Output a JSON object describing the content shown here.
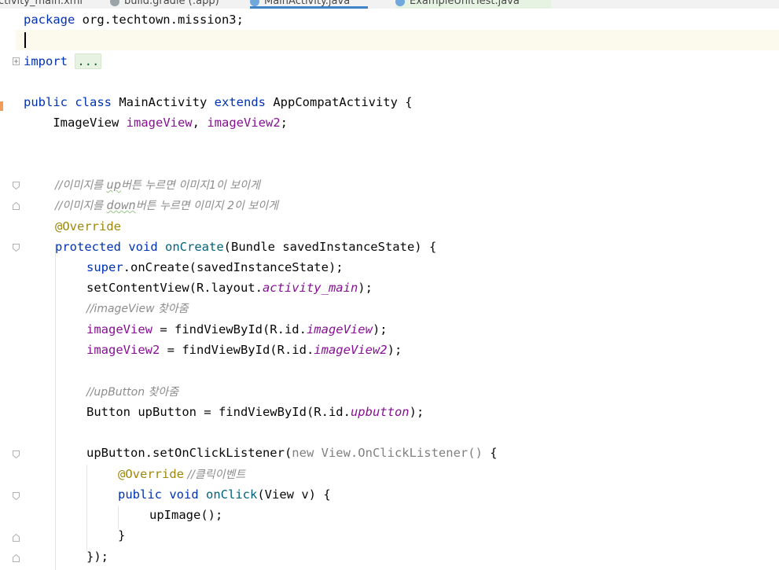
{
  "tabs": [
    {
      "label": "ctivity_main.xml"
    },
    {
      "label": "build.gradle (:app)"
    },
    {
      "label": "MainActivity.java"
    },
    {
      "label": "ExampleUnitTest.java"
    }
  ],
  "code": {
    "package_kw": "package",
    "package_name": " org.techtown.mission3;",
    "import_kw": "import",
    "import_fold": "...",
    "class_public": "public",
    "class_kw": "class",
    "class_name": " MainActivity ",
    "extends_kw": "extends",
    "super_class": " AppCompatActivity {",
    "field_type": "    ImageView ",
    "field1": "imageView",
    "field_sep": ", ",
    "field2": "imageView2",
    "field_end": ";",
    "comment1_prefix": "//이미지를 ",
    "comment1_up": "up",
    "comment1_rest": "버튼 누르면 이미지1이 보이게",
    "comment2_prefix": "//이미지를 ",
    "comment2_down": "down",
    "comment2_rest": "버튼 누르면 이미지 2이 보이게",
    "override": "@Override",
    "protected_kw": "protected",
    "void_kw": "void",
    "oncreate": "onCreate",
    "oncreate_params": "(Bundle savedInstanceState) {",
    "super_kw": "super",
    "super_call": ".onCreate(savedInstanceState);",
    "setcontent": "setContentView(R.layout.",
    "activity_main": "activity_main",
    "close_paren": ");",
    "comment_find_iv": "//imageView 찾아줌",
    "iv_assign": "imageView",
    "iv_find": " = findViewById(R.id.",
    "iv_id": "imageView",
    "iv2_assign": "imageView2",
    "iv2_id": "imageView2",
    "comment_find_btn": "//upButton 찾아줌",
    "btn_decl": "Button upButton = findViewById(R.id.",
    "btn_id": "upbutton",
    "listener_call": "upButton.setOnClickListener(",
    "new_kw": "new",
    "listener_anon": " View.OnClickListener()",
    "listener_open": " {",
    "override2": "@Override",
    "comment_click": " //클릭이벤트",
    "public_kw": "public",
    "void_kw2": "void",
    "onclick": "onClick",
    "onclick_params": "(View v) {",
    "upimage": "upImage();",
    "close_brace": "}",
    "close_call": "});"
  },
  "colors": {
    "keyword": "#0033b3",
    "field": "#871094",
    "annotation": "#9e880d",
    "method_decl": "#00627a",
    "comment": "#8c8c8c",
    "caret_line": "#fcfaed"
  }
}
